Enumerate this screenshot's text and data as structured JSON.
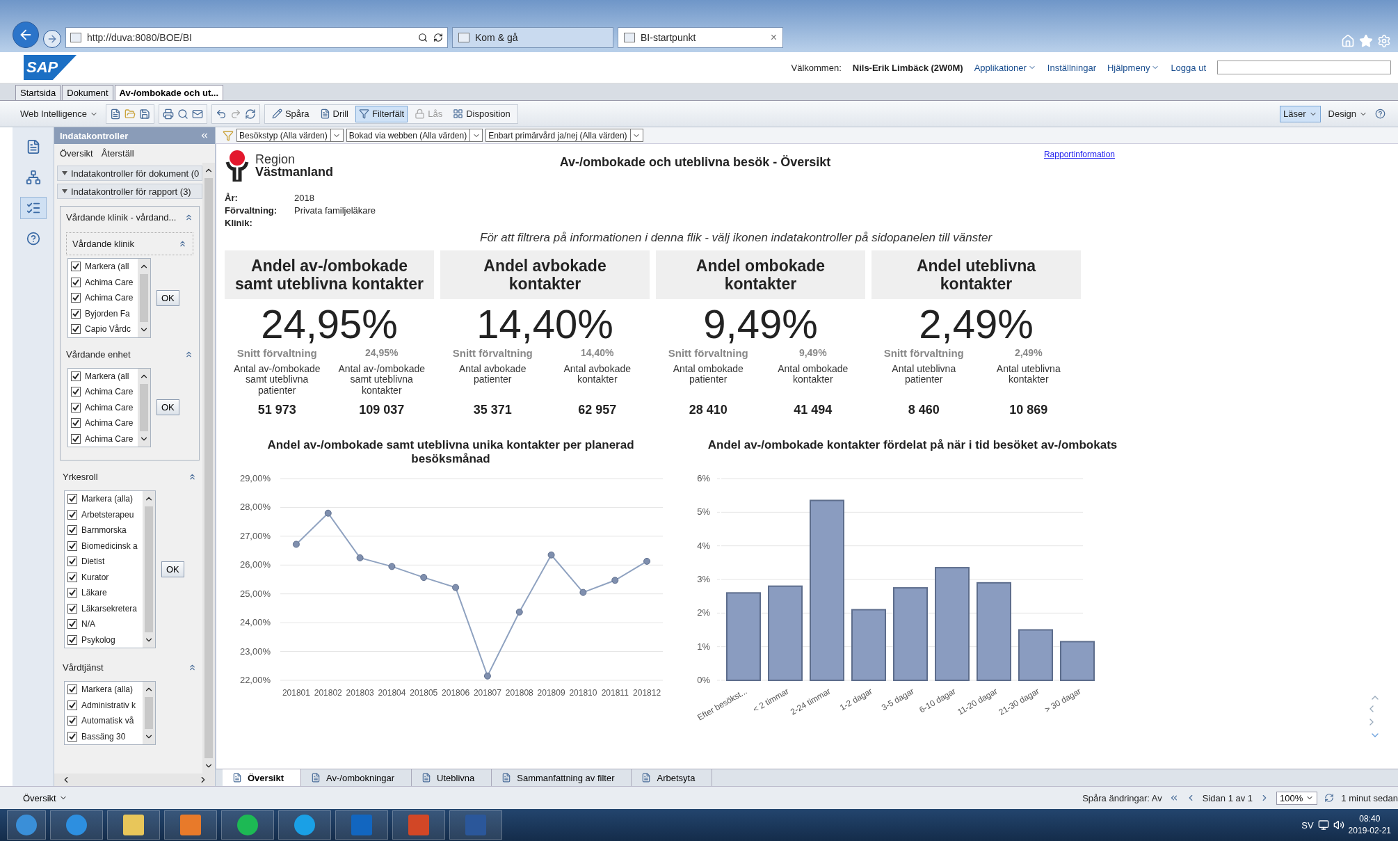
{
  "browser": {
    "url": "http://duva:8080/BOE/BI",
    "tabs": [
      {
        "label": "Kom & gå",
        "selected": false
      },
      {
        "label": "BI-startpunkt",
        "selected": true
      }
    ],
    "close": "×"
  },
  "header": {
    "logo": "SAP",
    "welcome": "Välkommen:",
    "user": "Nils-Erik Limbäck (2W0M)",
    "menus": [
      "Applikationer",
      "Inställningar",
      "Hjälpmeny"
    ],
    "logout": "Logga ut"
  },
  "doc_tabs": [
    {
      "label": "Startsida",
      "selected": false
    },
    {
      "label": "Dokument",
      "selected": false
    },
    {
      "label": "Av-/ombokade och ut...",
      "selected": true
    }
  ],
  "toolbar": {
    "app": "Web Intelligence",
    "items": [
      {
        "label": "Spåra",
        "active": false,
        "disabled": false
      },
      {
        "label": "Drill",
        "active": false,
        "disabled": false
      },
      {
        "label": "Filterfält",
        "active": true,
        "disabled": false
      },
      {
        "label": "Lås",
        "active": false,
        "disabled": true
      },
      {
        "label": "Disposition",
        "active": false,
        "disabled": false
      }
    ],
    "modes": [
      {
        "label": "Läser",
        "selected": true
      },
      {
        "label": "Design",
        "selected": false
      }
    ]
  },
  "filters": [
    "Besökstyp (Alla värden)",
    "Bokad via webben (Alla värden)",
    "Enbart primärvård ja/nej (Alla värden)"
  ],
  "left_panel": {
    "title": "Indatakontroller",
    "links": [
      "Översikt",
      "Återställ"
    ],
    "sections": [
      "Indatakontroller för dokument (0",
      "Indatakontroller för rapport (3)"
    ],
    "group": {
      "title": "Vårdande klinik - vårdand...",
      "controls": [
        {
          "title": "Vårdande klinik",
          "button": "OK",
          "items": [
            {
              "label": "Markera (all",
              "checked": true
            },
            {
              "label": "Achima Care",
              "checked": true
            },
            {
              "label": "Achima Care",
              "checked": true
            },
            {
              "label": "Byjorden Fa",
              "checked": true
            },
            {
              "label": "Capio Vårdc",
              "checked": true
            }
          ]
        },
        {
          "title": "Vårdande enhet",
          "button": "OK",
          "items": [
            {
              "label": "Markera (all",
              "checked": true
            },
            {
              "label": "Achima Care",
              "checked": true
            },
            {
              "label": "Achima Care",
              "checked": true
            },
            {
              "label": "Achima Care",
              "checked": true
            },
            {
              "label": "Achima Care",
              "checked": true
            }
          ]
        }
      ]
    },
    "controls": [
      {
        "title": "Yrkesroll",
        "button": "OK",
        "items": [
          {
            "label": "Markera (alla)",
            "checked": true
          },
          {
            "label": "Arbetsterapeu",
            "checked": true
          },
          {
            "label": "Barnmorska",
            "checked": true
          },
          {
            "label": "Biomedicinsk a",
            "checked": true
          },
          {
            "label": "Dietist",
            "checked": true
          },
          {
            "label": "Kurator",
            "checked": true
          },
          {
            "label": "Läkare",
            "checked": true
          },
          {
            "label": "Läkarsekretera",
            "checked": true
          },
          {
            "label": "N/A",
            "checked": true
          },
          {
            "label": "Psykolog",
            "checked": true
          }
        ]
      },
      {
        "title": "Vårdtjänst",
        "items": [
          {
            "label": "Markera (alla)",
            "checked": true
          },
          {
            "label": "Administrativ k",
            "checked": true
          },
          {
            "label": "Automatisk vå",
            "checked": true
          },
          {
            "label": "Bassäng 30",
            "checked": true
          }
        ]
      }
    ]
  },
  "report": {
    "logo": {
      "line1": "Region",
      "line2": "Västmanland"
    },
    "title": "Av-/ombokade och uteblivna besök - Översikt",
    "link": "Rapportinformation",
    "meta": [
      {
        "label": "År:",
        "value": "2018"
      },
      {
        "label": "Förvaltning:",
        "value": "Privata familjeläkare"
      },
      {
        "label": "Klinik:"
      }
    ],
    "note": "För att filtrera på informationen i denna flik - välj ikonen indatakontroller på sidopanelen till vänster",
    "kpis": [
      {
        "title": "Andel av-/ombokade samt uteblivna kontakter",
        "value": "24,95%",
        "avg_label": "Snitt förvaltning",
        "avg_value": "24,95%",
        "stats": [
          {
            "label": "Antal av-/ombokade samt uteblivna patienter",
            "value": "51 973"
          },
          {
            "label": "Antal av-/ombokade samt uteblivna kontakter",
            "value": "109 037"
          }
        ]
      },
      {
        "title": "Andel avbokade kontakter",
        "value": "14,40%",
        "avg_label": "Snitt förvaltning",
        "avg_value": "14,40%",
        "stats": [
          {
            "label": "Antal avbokade patienter",
            "value": "35 371"
          },
          {
            "label": "Antal avbokade kontakter",
            "value": "62 957"
          }
        ]
      },
      {
        "title": "Andel ombokade kontakter",
        "value": "9,49%",
        "avg_label": "Snitt förvaltning",
        "avg_value": "9,49%",
        "stats": [
          {
            "label": "Antal ombokade patienter",
            "value": "28 410"
          },
          {
            "label": "Antal ombokade kontakter",
            "value": "41 494"
          }
        ]
      },
      {
        "title": "Andel uteblivna kontakter",
        "value": "2,49%",
        "avg_label": "Snitt förvaltning",
        "avg_value": "2,49%",
        "stats": [
          {
            "label": "Antal uteblivna patienter",
            "value": "8 460"
          },
          {
            "label": "Antal uteblivna kontakter",
            "value": "10 869"
          }
        ]
      }
    ],
    "charts": [
      {
        "chart_data": {
          "type": "line",
          "title": "Andel av-/ombokade samt uteblivna unika kontakter per planerad besöksmånad",
          "categories": [
            "201801",
            "201802",
            "201803",
            "201804",
            "201805",
            "201806",
            "201807",
            "201808",
            "201809",
            "201810",
            "201811",
            "201812"
          ],
          "grid": true,
          "series": [
            {
              "color": "#8fa2c0",
              "marker": true,
              "values": [
                26.72,
                27.8,
                26.25,
                25.95,
                25.57,
                25.22,
                22.15,
                24.37,
                26.35,
                25.05,
                25.47,
                26.13
              ]
            }
          ],
          "ylim": [
            22,
            29
          ],
          "yticks": [
            {
              "value": 22,
              "label": "22,00%"
            },
            {
              "value": 23,
              "label": "23,00%"
            },
            {
              "value": 24,
              "label": "24,00%"
            },
            {
              "value": 25,
              "label": "25,00%"
            },
            {
              "value": 26,
              "label": "26,00%"
            },
            {
              "value": 27,
              "label": "27,00%"
            },
            {
              "value": 28,
              "label": "28,00%"
            },
            {
              "value": 29,
              "label": "29,00%"
            }
          ]
        }
      },
      {
        "chart_data": {
          "type": "bar",
          "title": "Andel av-/ombokade kontakter fördelat på när i tid besöket  av-/ombokats",
          "categories": [
            "Efter besökst...",
            "< 2 timmar",
            "2-24 timmar",
            "1-2 dagar",
            "3-5 dagar",
            "6-10 dagar",
            "11-20 dagar",
            "21-30 dagar",
            "> 30 dagar"
          ],
          "grid": true,
          "series": [
            {
              "color": "#8a9cc0",
              "values": [
                2.6,
                2.8,
                5.35,
                2.1,
                2.75,
                3.35,
                2.9,
                1.5,
                1.15
              ]
            }
          ],
          "ylim": [
            0,
            6
          ],
          "yticks": [
            {
              "value": 0,
              "label": "0%"
            },
            {
              "value": 1,
              "label": "1%"
            },
            {
              "value": 2,
              "label": "2%"
            },
            {
              "value": 3,
              "label": "3%"
            },
            {
              "value": 4,
              "label": "4%"
            },
            {
              "value": 5,
              "label": "5%"
            },
            {
              "value": 6,
              "label": "6%"
            }
          ]
        }
      }
    ],
    "tabs": [
      {
        "label": "Översikt",
        "selected": true
      },
      {
        "label": "Av-/ombokningar",
        "selected": false
      },
      {
        "label": "Uteblivna",
        "selected": false
      },
      {
        "label": "Sammanfattning av filter",
        "selected": false
      },
      {
        "label": "Arbetsyta",
        "selected": false
      }
    ]
  },
  "status": {
    "view": "Översikt",
    "track": "Spåra ändringar: Av",
    "page": "Sidan 1 av 1",
    "zoom": "100%",
    "refresh": "1 minut sedan"
  },
  "taskbar": {
    "language": "SV",
    "time": "08:40",
    "date": "2019-02-21"
  }
}
